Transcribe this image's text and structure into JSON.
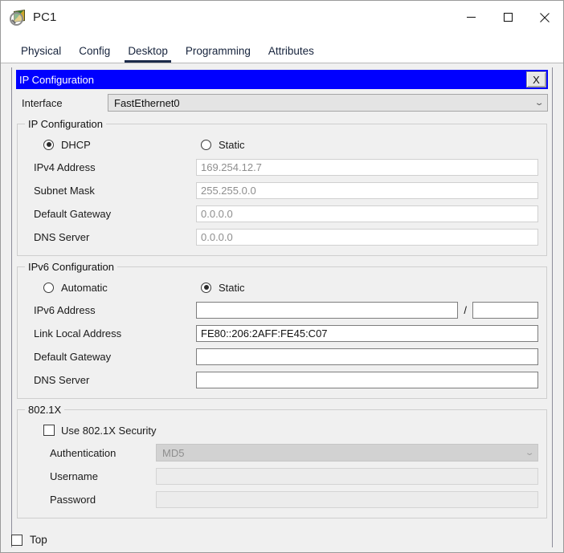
{
  "window": {
    "title": "PC1",
    "icon": "packet-tracer-pc-icon",
    "minimize_label": "Minimize",
    "maximize_label": "Maximize",
    "close_label": "Close"
  },
  "tabs": [
    {
      "label": "Physical",
      "active": false
    },
    {
      "label": "Config",
      "active": false
    },
    {
      "label": "Desktop",
      "active": true
    },
    {
      "label": "Programming",
      "active": false
    },
    {
      "label": "Attributes",
      "active": false
    }
  ],
  "dialog": {
    "title": "IP Configuration",
    "close_label": "X",
    "titlebar_color": "#0000ff"
  },
  "interface": {
    "label": "Interface",
    "value": "FastEthernet0",
    "chevron": "chevron-down-icon"
  },
  "ipv4": {
    "legend": "IP Configuration",
    "mode": {
      "dhcp_label": "DHCP",
      "dhcp_selected": true,
      "static_label": "Static",
      "static_selected": false
    },
    "fields": [
      {
        "label": "IPv4 Address",
        "value": "169.254.12.7",
        "disabled": true
      },
      {
        "label": "Subnet Mask",
        "value": "255.255.0.0",
        "disabled": true
      },
      {
        "label": "Default Gateway",
        "value": "0.0.0.0",
        "disabled": true
      },
      {
        "label": "DNS Server",
        "value": "0.0.0.0",
        "disabled": true
      }
    ]
  },
  "ipv6": {
    "legend": "IPv6 Configuration",
    "mode": {
      "automatic_label": "Automatic",
      "automatic_selected": false,
      "static_label": "Static",
      "static_selected": true
    },
    "address": {
      "label": "IPv6 Address",
      "value": "",
      "separator": "/",
      "prefix_value": ""
    },
    "fields": [
      {
        "label": "Link Local Address",
        "value": "FE80::206:2AFF:FE45:C07"
      },
      {
        "label": "Default Gateway",
        "value": ""
      },
      {
        "label": "DNS Server",
        "value": ""
      }
    ]
  },
  "dot1x": {
    "legend": "802.1X",
    "use_security_label": "Use 802.1X Security",
    "use_security_checked": false,
    "authentication": {
      "label": "Authentication",
      "value": "MD5",
      "disabled": true,
      "chevron": "chevron-down-icon"
    },
    "username": {
      "label": "Username",
      "value": "",
      "disabled": true
    },
    "password": {
      "label": "Password",
      "value": "",
      "disabled": true
    }
  },
  "footer": {
    "top_label": "Top",
    "top_checked": false
  }
}
